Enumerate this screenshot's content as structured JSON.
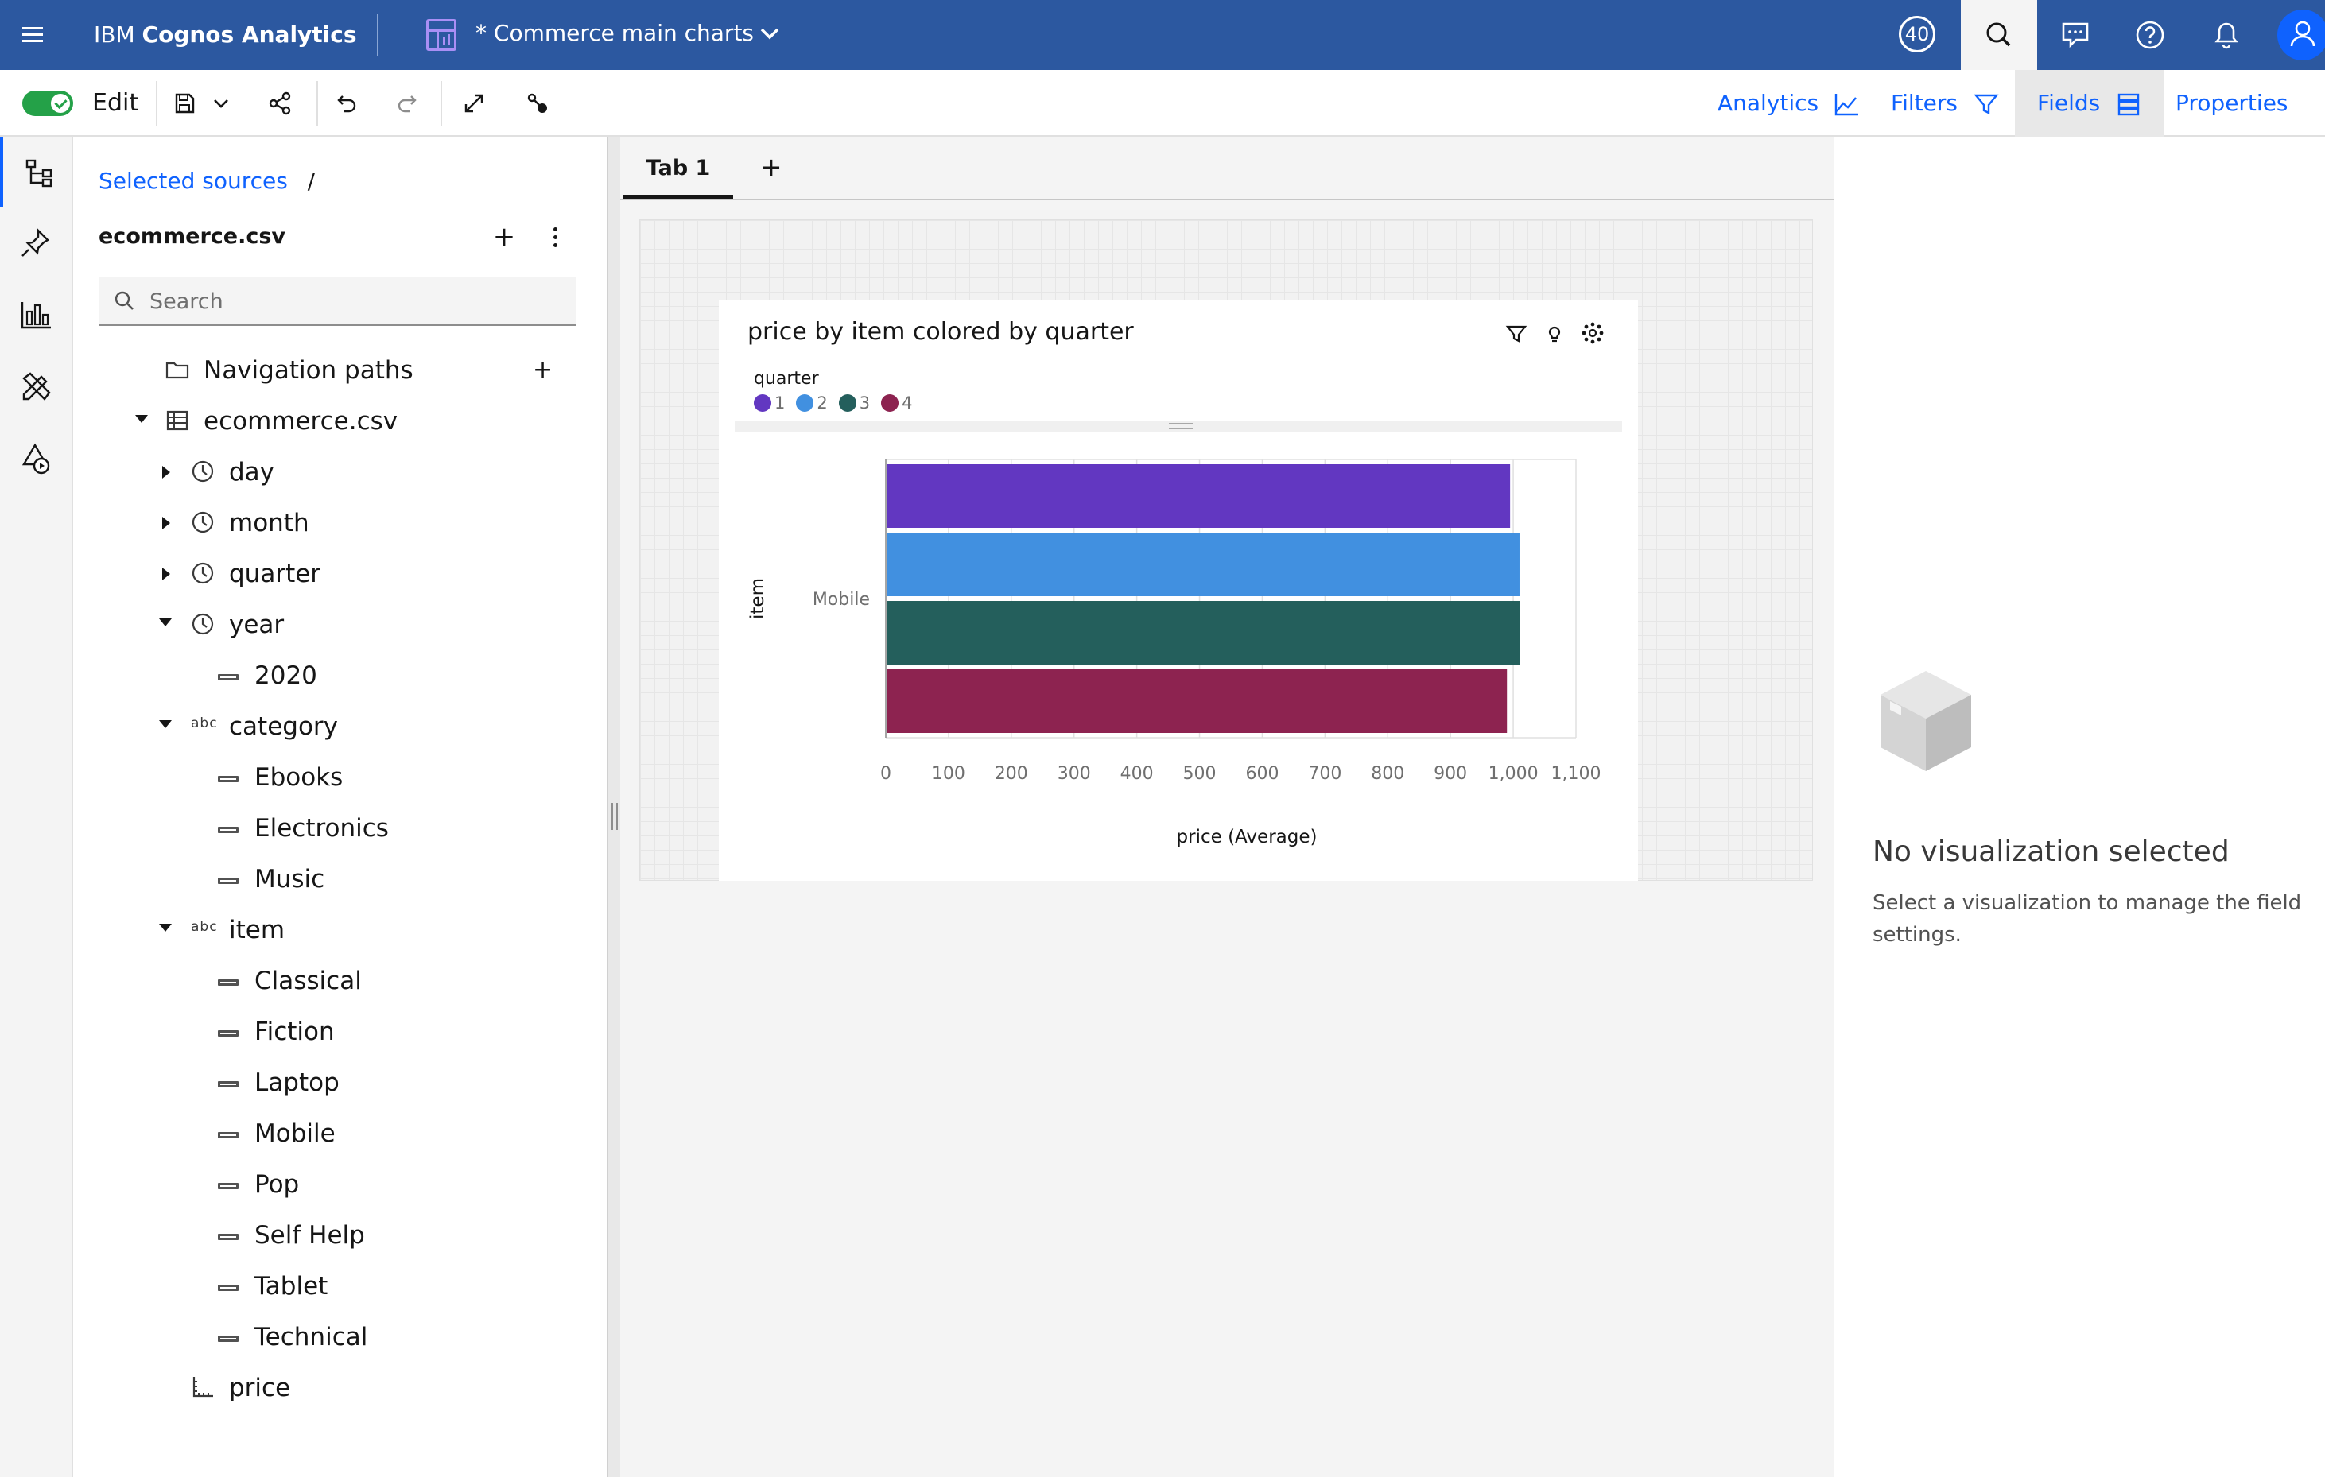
{
  "header": {
    "brand_prefix": "IBM",
    "brand_name": "Cognos Analytics",
    "doc_title": "* Commerce main charts",
    "notification_count": "40"
  },
  "toolbar": {
    "edit_label": "Edit",
    "edit_mode_on": true,
    "tabs": {
      "analytics": "Analytics",
      "filters": "Filters",
      "fields": "Fields",
      "properties": "Properties"
    },
    "active_tab": "Fields"
  },
  "source_panel": {
    "breadcrumb_link": "Selected sources",
    "breadcrumb_sep": "/",
    "source_name": "ecommerce.csv",
    "search_placeholder": "Search",
    "tree": {
      "navigation_paths": "Navigation paths",
      "dataset": "ecommerce.csv",
      "day": "day",
      "month": "month",
      "quarter": "quarter",
      "year": "year",
      "year_members": [
        "2020"
      ],
      "category": "category",
      "category_members": [
        "Ebooks",
        "Electronics",
        "Music"
      ],
      "item": "item",
      "item_members": [
        "Classical",
        "Fiction",
        "Laptop",
        "Mobile",
        "Pop",
        "Self Help",
        "Tablet",
        "Technical"
      ],
      "price": "price",
      "abc_glyph": "abc"
    }
  },
  "canvas": {
    "tab_label": "Tab 1",
    "add_tab": "+"
  },
  "properties_panel": {
    "empty_title": "No visualization selected",
    "empty_text": "Select a visualization to manage the field settings."
  },
  "chart_data": {
    "type": "bar",
    "orientation": "horizontal",
    "title": "price by item colored by quarter",
    "legend_title": "quarter",
    "legend_placement": "top-left",
    "categories": [
      "Mobile"
    ],
    "series": [
      {
        "name": "1",
        "color": "#6237c1",
        "values": [
          995
        ]
      },
      {
        "name": "2",
        "color": "#4190e0",
        "values": [
          1010
        ]
      },
      {
        "name": "3",
        "color": "#245f5c",
        "values": [
          1011
        ]
      },
      {
        "name": "4",
        "color": "#8d2350",
        "values": [
          990
        ]
      }
    ],
    "xlabel": "price (Average)",
    "ylabel": "item",
    "xlim": [
      0,
      1100
    ],
    "x_ticks": [
      0,
      100,
      200,
      300,
      400,
      500,
      600,
      700,
      800,
      900,
      1000,
      1100
    ],
    "x_tick_labels": [
      "0",
      "100",
      "200",
      "300",
      "400",
      "500",
      "600",
      "700",
      "800",
      "900",
      "1,000",
      "1,100"
    ],
    "grid": true
  }
}
